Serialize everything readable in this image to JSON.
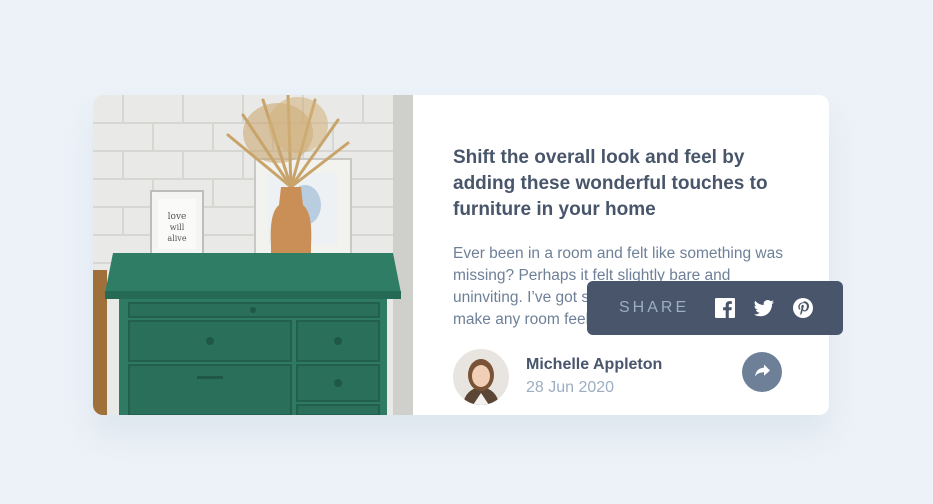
{
  "article": {
    "title": "Shift the overall look and feel by adding these wonderful touches to furniture in your home",
    "excerpt": "Ever been in a room and felt like something was missing? Perhaps it felt slightly bare and uninviting. I’ve got some simple tips to help you make any room feel complete."
  },
  "author": {
    "name": "Michelle Appleton",
    "date": "28 Jun 2020"
  },
  "share": {
    "label": "SHARE",
    "networks": [
      "facebook-icon",
      "twitter-icon",
      "pinterest-icon"
    ]
  },
  "colors": {
    "background": "#ecf2f8",
    "card": "#ffffff",
    "heading": "#48556a",
    "body_text": "#6e8098",
    "muted": "#9daec2",
    "popup": "#48556a"
  }
}
